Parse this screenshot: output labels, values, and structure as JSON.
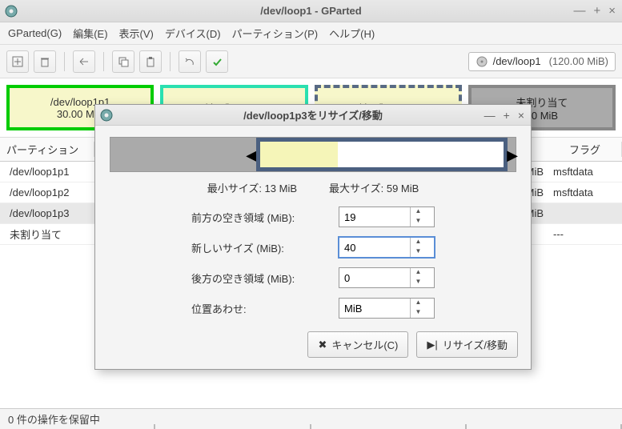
{
  "window": {
    "title": "/dev/loop1 - GParted"
  },
  "menu": {
    "gparted": "GParted(G)",
    "edit": "編集(E)",
    "view": "表示(V)",
    "device": "デバイス(D)",
    "partition": "パーティション(P)",
    "help": "ヘルプ(H)"
  },
  "device_selector": {
    "device": "/dev/loop1",
    "size": "(120.00 MiB)"
  },
  "diskmap": {
    "p1": {
      "name": "/dev/loop1p1",
      "size": "30.00 MiB"
    },
    "p2": {
      "name": "/dev/loop1p2"
    },
    "p3": {
      "name": "/dev/loop1p3"
    },
    "unalloc": {
      "name": "未割り当て",
      "size": "00 MiB"
    }
  },
  "table": {
    "hdr_partition": "パーティション",
    "hdr_flags": "フラグ",
    "rows": [
      {
        "part": "/dev/loop1p1",
        "rcol": "MiB",
        "flags": "msftdata"
      },
      {
        "part": "/dev/loop1p2",
        "rcol": "MiB",
        "flags": "msftdata"
      },
      {
        "part": "/dev/loop1p3",
        "rcol": "MiB",
        "flags": ""
      },
      {
        "part": "未割り当て",
        "rcol": "",
        "flags": "---"
      }
    ]
  },
  "status": "0 件の操作を保留中",
  "dialog": {
    "title": "/dev/loop1p3をリサイズ/移動",
    "min_size": "最小サイズ: 13 MiB",
    "max_size": "最大サイズ: 59 MiB",
    "lbl_preceding": "前方の空き領域 (MiB):",
    "val_preceding": "19",
    "lbl_newsize": "新しいサイズ (MiB):",
    "val_newsize": "40",
    "lbl_following": "後方の空き領域 (MiB):",
    "val_following": "0",
    "lbl_align": "位置あわせ:",
    "val_align": "MiB",
    "btn_cancel": "キャンセル(C)",
    "btn_resize": "リサイズ/移動"
  }
}
